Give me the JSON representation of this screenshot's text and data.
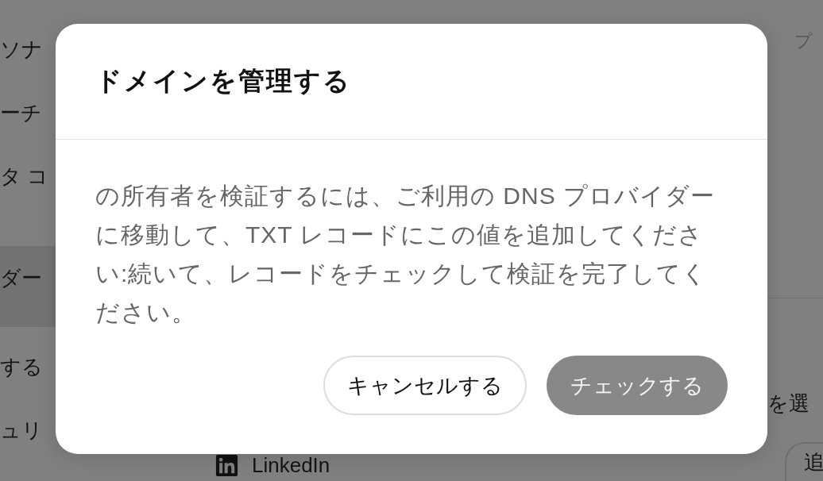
{
  "sidebar": {
    "items": [
      {
        "label": "ソナ",
        "selected": false
      },
      {
        "label": "ーチ",
        "selected": false
      },
      {
        "label": "タ コ",
        "selected": false
      },
      {
        "label": "ダー",
        "selected": true
      },
      {
        "label": "する",
        "selected": false
      },
      {
        "label": "ュリ",
        "selected": false
      }
    ]
  },
  "accounts": [
    {
      "label": "LinkedIn"
    }
  ],
  "right_panel": {
    "label": "プ",
    "text": "を選",
    "button": "追"
  },
  "dialog": {
    "title": "ドメインを管理する",
    "message": "の所有者を検証するには、ご利用の DNS プロバイダーに移動して、TXT レコードにこの値を追加してください:続いて、レコードをチェックして検証を完了してください。",
    "buttons": [
      {
        "label": "キャンセルする",
        "kind": "secondary",
        "disabled": false
      },
      {
        "label": "チェックする",
        "kind": "primary",
        "disabled": true
      }
    ]
  }
}
